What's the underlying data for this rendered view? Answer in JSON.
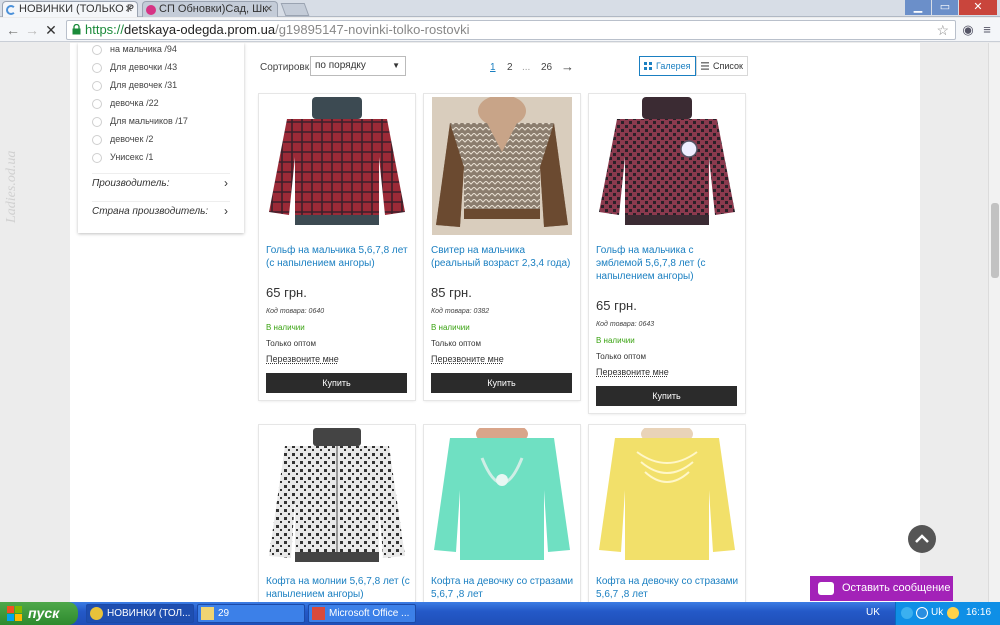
{
  "browser": {
    "tabs": [
      {
        "label": "НОВИНКИ (ТОЛЬКО Р",
        "active": true
      },
      {
        "label": "СП Обновки)Сад, Шк",
        "active": false
      }
    ],
    "url_https": "https://",
    "url_host": "detskaya-odegda.prom.ua",
    "url_path": "/g19895147-novinki-tolko-rostovki"
  },
  "watermark": "Ladies.od.ua",
  "filters": {
    "items": [
      {
        "label": "на мальчика",
        "count": "/94"
      },
      {
        "label": "Для девочки",
        "count": "/43"
      },
      {
        "label": "Для девочек",
        "count": "/31"
      },
      {
        "label": "девочка",
        "count": "/22"
      },
      {
        "label": "Для мальчиков",
        "count": "/17"
      },
      {
        "label": "девочек",
        "count": "/2"
      },
      {
        "label": "Унисекс",
        "count": "/1"
      }
    ],
    "groups": [
      "Производитель:",
      "Страна производитель:"
    ]
  },
  "sort": {
    "label": "Сортировка:",
    "value": "по порядку"
  },
  "pagination": {
    "pages": [
      "1",
      "2",
      "...",
      "26"
    ],
    "next": "→",
    "current": "1"
  },
  "view": {
    "gallery": "Галерея",
    "list": "Список"
  },
  "products": [
    {
      "title": "Гольф на мальчика 5,6,7,8 лет (с напылением ангоры)",
      "price": "65 грн.",
      "code": "Код товара: 0640",
      "stock": "В наличии",
      "wholesale": "Только оптом",
      "callback": "Перезвоните мне",
      "buy": "Купить"
    },
    {
      "title": "Свитер на мальчика (реальный возраст 2,3,4 года)",
      "price": "85 грн.",
      "code": "Код товара: 0382",
      "stock": "В наличии",
      "wholesale": "Только оптом",
      "callback": "Перезвоните мне",
      "buy": "Купить"
    },
    {
      "title": "Гольф на мальчика с эмблемой 5,6,7,8 лет (с напылением ангоры)",
      "price": "65 грн.",
      "code": "Код товара: 0643",
      "stock": "В наличии",
      "wholesale": "Только оптом",
      "callback": "Перезвоните мне",
      "buy": "Купить"
    },
    {
      "title": "Кофта на молнии 5,6,7,8 лет (с напылением ангоры)"
    },
    {
      "title": "Кофта на девочку со стразами 5,6,7 ,8 лет"
    },
    {
      "title": "Кофта на девочку со стразами 5,6,7 ,8 лет"
    }
  ],
  "chat": {
    "label": "Оставить сообщение"
  },
  "taskbar": {
    "start": "пуск",
    "items": [
      "НОВИНКИ (ТОЛ...",
      "29",
      "Microsoft Office ..."
    ],
    "lang": "UK",
    "lang2": "Uk",
    "clock": "16:16"
  },
  "colors": {
    "accent": "#1a7fc1",
    "stock": "#3aa312",
    "chat": "#a322b8",
    "buy": "#2b2b2b"
  }
}
